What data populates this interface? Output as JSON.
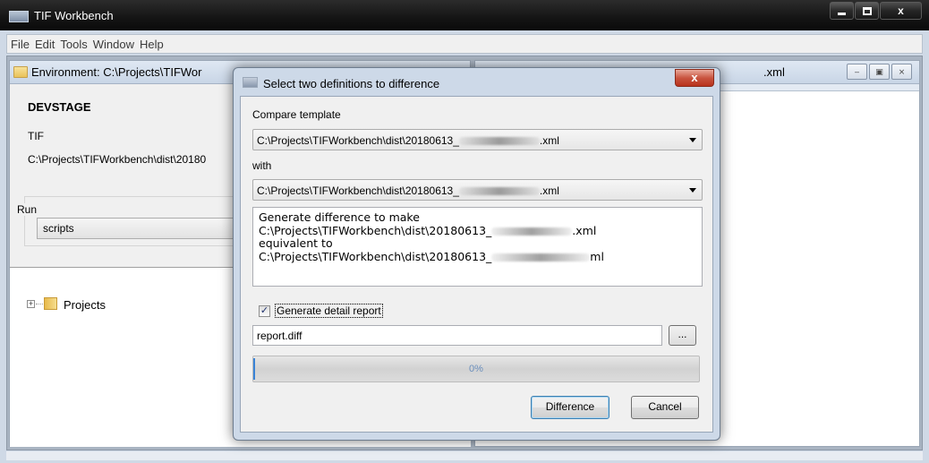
{
  "window": {
    "title": "TIF Workbench",
    "controls": {
      "minimize": "–",
      "maximize": "□",
      "close": "x"
    }
  },
  "menubar": [
    "File",
    "Edit",
    "Tools",
    "Window",
    "Help"
  ],
  "environment_frame": {
    "title": "Environment: C:\\Projects\\TIFWor",
    "stage_name": "DEVSTAGE",
    "type": "TIF",
    "path": "C:\\Projects\\TIFWorkbench\\dist\\20180",
    "run_label": "Run",
    "run_selection": "scripts",
    "tree": {
      "expander": "+",
      "root_label": "Projects"
    }
  },
  "xml_frame": {
    "title_suffix": ".xml",
    "controls": {
      "minimize": "–",
      "restore": "▣",
      "close": "⨯"
    }
  },
  "dialog": {
    "title": "Select two definitions to difference",
    "close_label": "x",
    "compare_label": "Compare template",
    "template_prefix": "C:\\Projects\\TIFWorkbench\\dist\\20180613_",
    "template_suffix": ".xml",
    "with_label": "with",
    "target_prefix": "C:\\Projects\\TIFWorkbench\\dist\\20180613_",
    "target_suffix": ".xml",
    "description": {
      "line1": "Generate difference to make",
      "line2_prefix": "C:\\Projects\\TIFWorkbench\\dist\\20180613_",
      "line2_suffix": ".xml",
      "line3": "equivalent to",
      "line4_prefix": "C:\\Projects\\TIFWorkbench\\dist\\20180613_",
      "line4_suffix": "ml"
    },
    "detail_report": {
      "checked": true,
      "check_glyph": "✓",
      "label": "Generate detail report"
    },
    "report_file": "report.diff",
    "browse_label": "...",
    "progress": {
      "value": 0,
      "label": "0%"
    },
    "difference_button": "Difference",
    "cancel_button": "Cancel"
  },
  "colors": {
    "titlebar": "#141414",
    "frame": "#cfd9e6",
    "dialog_close": "#c95540",
    "progress_edge": "#3a83d6"
  }
}
